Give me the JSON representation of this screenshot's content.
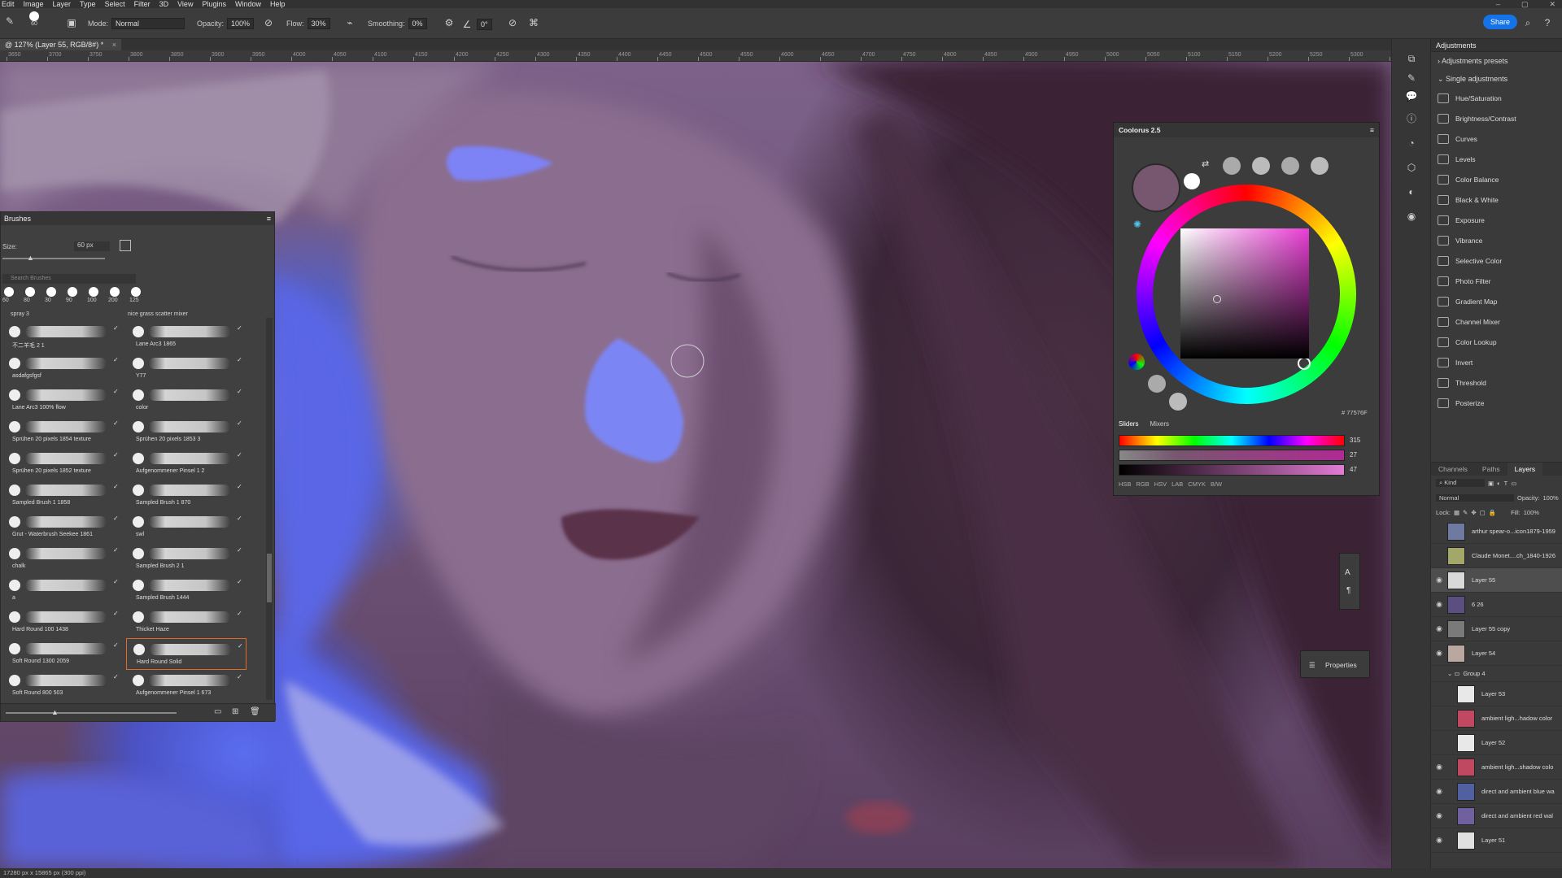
{
  "menu": [
    "Edit",
    "Image",
    "Layer",
    "Type",
    "Select",
    "Filter",
    "3D",
    "View",
    "Plugins",
    "Window",
    "Help"
  ],
  "options": {
    "brush_size": "60",
    "mode_label": "Mode:",
    "mode_value": "Normal",
    "opacity_label": "Opacity:",
    "opacity_value": "100%",
    "flow_label": "Flow:",
    "flow_value": "30%",
    "smoothing_label": "Smoothing:",
    "smoothing_value": "0%",
    "angle_value": "0°",
    "share_label": "Share"
  },
  "document_tab": {
    "title": "@ 127% (Layer 55, RGB/8#) *",
    "close": "×"
  },
  "ruler_ticks": [
    "3650",
    "3700",
    "3750",
    "3800",
    "3850",
    "3900",
    "3950",
    "4000",
    "4050",
    "4100",
    "4150",
    "4200",
    "4250",
    "4300",
    "4350",
    "4400",
    "4450",
    "4500",
    "4550",
    "4600",
    "4650",
    "4700",
    "4750",
    "4800",
    "4850",
    "4900",
    "4950",
    "5000",
    "5050",
    "5100",
    "5150",
    "5200",
    "5250",
    "5300",
    "5350"
  ],
  "brushes": {
    "title": "Brushes",
    "size_label": "Size:",
    "size_value": "60 px",
    "search_placeholder": "Search Brushes",
    "presets": [
      "60",
      "80",
      "30",
      "90",
      "100",
      "200",
      "125"
    ],
    "group_left": "spray 3",
    "group_right": "nice grass scatter mixer",
    "items_left": [
      "不二羊毛 2 1",
      "asdafgsfgsf",
      "Lane Arc3 100% flow",
      "Sprühen 20 pixels 1854 texture",
      "Sprühen 20 pixels 1852 texture",
      "Sampled Brush 1 1858",
      "Grut - Waterbrush Seekee 1861",
      "chalk",
      "a",
      "Hard Round 100 1438",
      "Soft Round 1300 2059",
      "Soft Round 800 503"
    ],
    "items_right": [
      "Lane Arc3 1865",
      "Y77",
      "color",
      "Sprühen 20 pixels 1853 3",
      "Aufgenommener Pinsel 1 2",
      "Sampled Brush 1 870",
      "swl",
      "Sampled Brush 2 1",
      "Sampled Brush 1444",
      "Thicket Haze",
      "Hard Round Solid",
      "Aufgenommener Pinsel 1 673"
    ],
    "selected_right_index": 10
  },
  "coolorus": {
    "title": "Coolorus 2.5",
    "hex": "# 77576F",
    "tab_sliders": "Sliders",
    "tab_mixers": "Mixers",
    "slider_values": [
      "315",
      "27",
      "47"
    ],
    "modes": [
      "HSB",
      "RGB",
      "HSV",
      "LAB",
      "CMYK",
      "B/W"
    ],
    "current_color": "#77576f",
    "hue_color": "#e93ed4"
  },
  "properties_label": "Properties",
  "adjustments": {
    "title": "Adjustments",
    "presets_label": "Adjustments presets",
    "single_label": "Single adjustments",
    "items": [
      "Hue/Saturation",
      "Brightness/Contrast",
      "Curves",
      "Levels",
      "Color Balance",
      "Black & White",
      "Exposure",
      "Vibrance",
      "Selective Color",
      "Photo Filter",
      "Gradient Map",
      "Channel Mixer",
      "Color Lookup",
      "Invert",
      "Threshold",
      "Posterize"
    ]
  },
  "layers": {
    "tabs": [
      "Channels",
      "Paths",
      "Layers"
    ],
    "kind_label": "Kind",
    "blend_mode": "Normal",
    "opacity_label": "Opacity:",
    "opacity_value": "100%",
    "lock_label": "Lock:",
    "fill_label": "Fill:",
    "fill_value": "100%",
    "rows": [
      {
        "name": "arthur spear-o...icon1879-1959",
        "visible": false,
        "selected": false,
        "thumb": "#6f7aa0"
      },
      {
        "name": "Claude Monet....ch_1840-1926",
        "visible": false,
        "selected": false,
        "thumb": "#a3a86a"
      },
      {
        "name": "Layer 55",
        "visible": true,
        "selected": true,
        "thumb": "#d9d9d9"
      },
      {
        "name": "6 26",
        "visible": true,
        "selected": false,
        "thumb": "#5a4f80"
      },
      {
        "name": "Layer 55 copy",
        "visible": true,
        "selected": false,
        "thumb": "#7a7a7a"
      },
      {
        "name": "Layer 54",
        "visible": true,
        "selected": false,
        "thumb": "#b8a8a0"
      },
      {
        "name": "Group 4",
        "visible": false,
        "selected": false,
        "group": true
      },
      {
        "name": "Layer 53",
        "visible": false,
        "selected": false,
        "thumb": "#e8e8e8",
        "indent": true
      },
      {
        "name": "ambient ligh...hadow color",
        "visible": false,
        "selected": false,
        "thumb": "#c04860",
        "indent": true
      },
      {
        "name": "Layer 52",
        "visible": false,
        "selected": false,
        "thumb": "#e8e8e8",
        "indent": true
      },
      {
        "name": "ambient ligh...shadow colo",
        "visible": true,
        "selected": false,
        "thumb": "#c04860",
        "indent": true
      },
      {
        "name": "direct and ambient blue wa",
        "visible": true,
        "selected": false,
        "thumb": "#5060a0",
        "indent": true
      },
      {
        "name": "direct and ambient red wal",
        "visible": true,
        "selected": false,
        "thumb": "#7060a0",
        "indent": true
      },
      {
        "name": "Layer 51",
        "visible": true,
        "selected": false,
        "thumb": "#e0e0e0",
        "indent": true
      }
    ]
  },
  "status_text": "17280 px x 15865 px (300 ppi)"
}
